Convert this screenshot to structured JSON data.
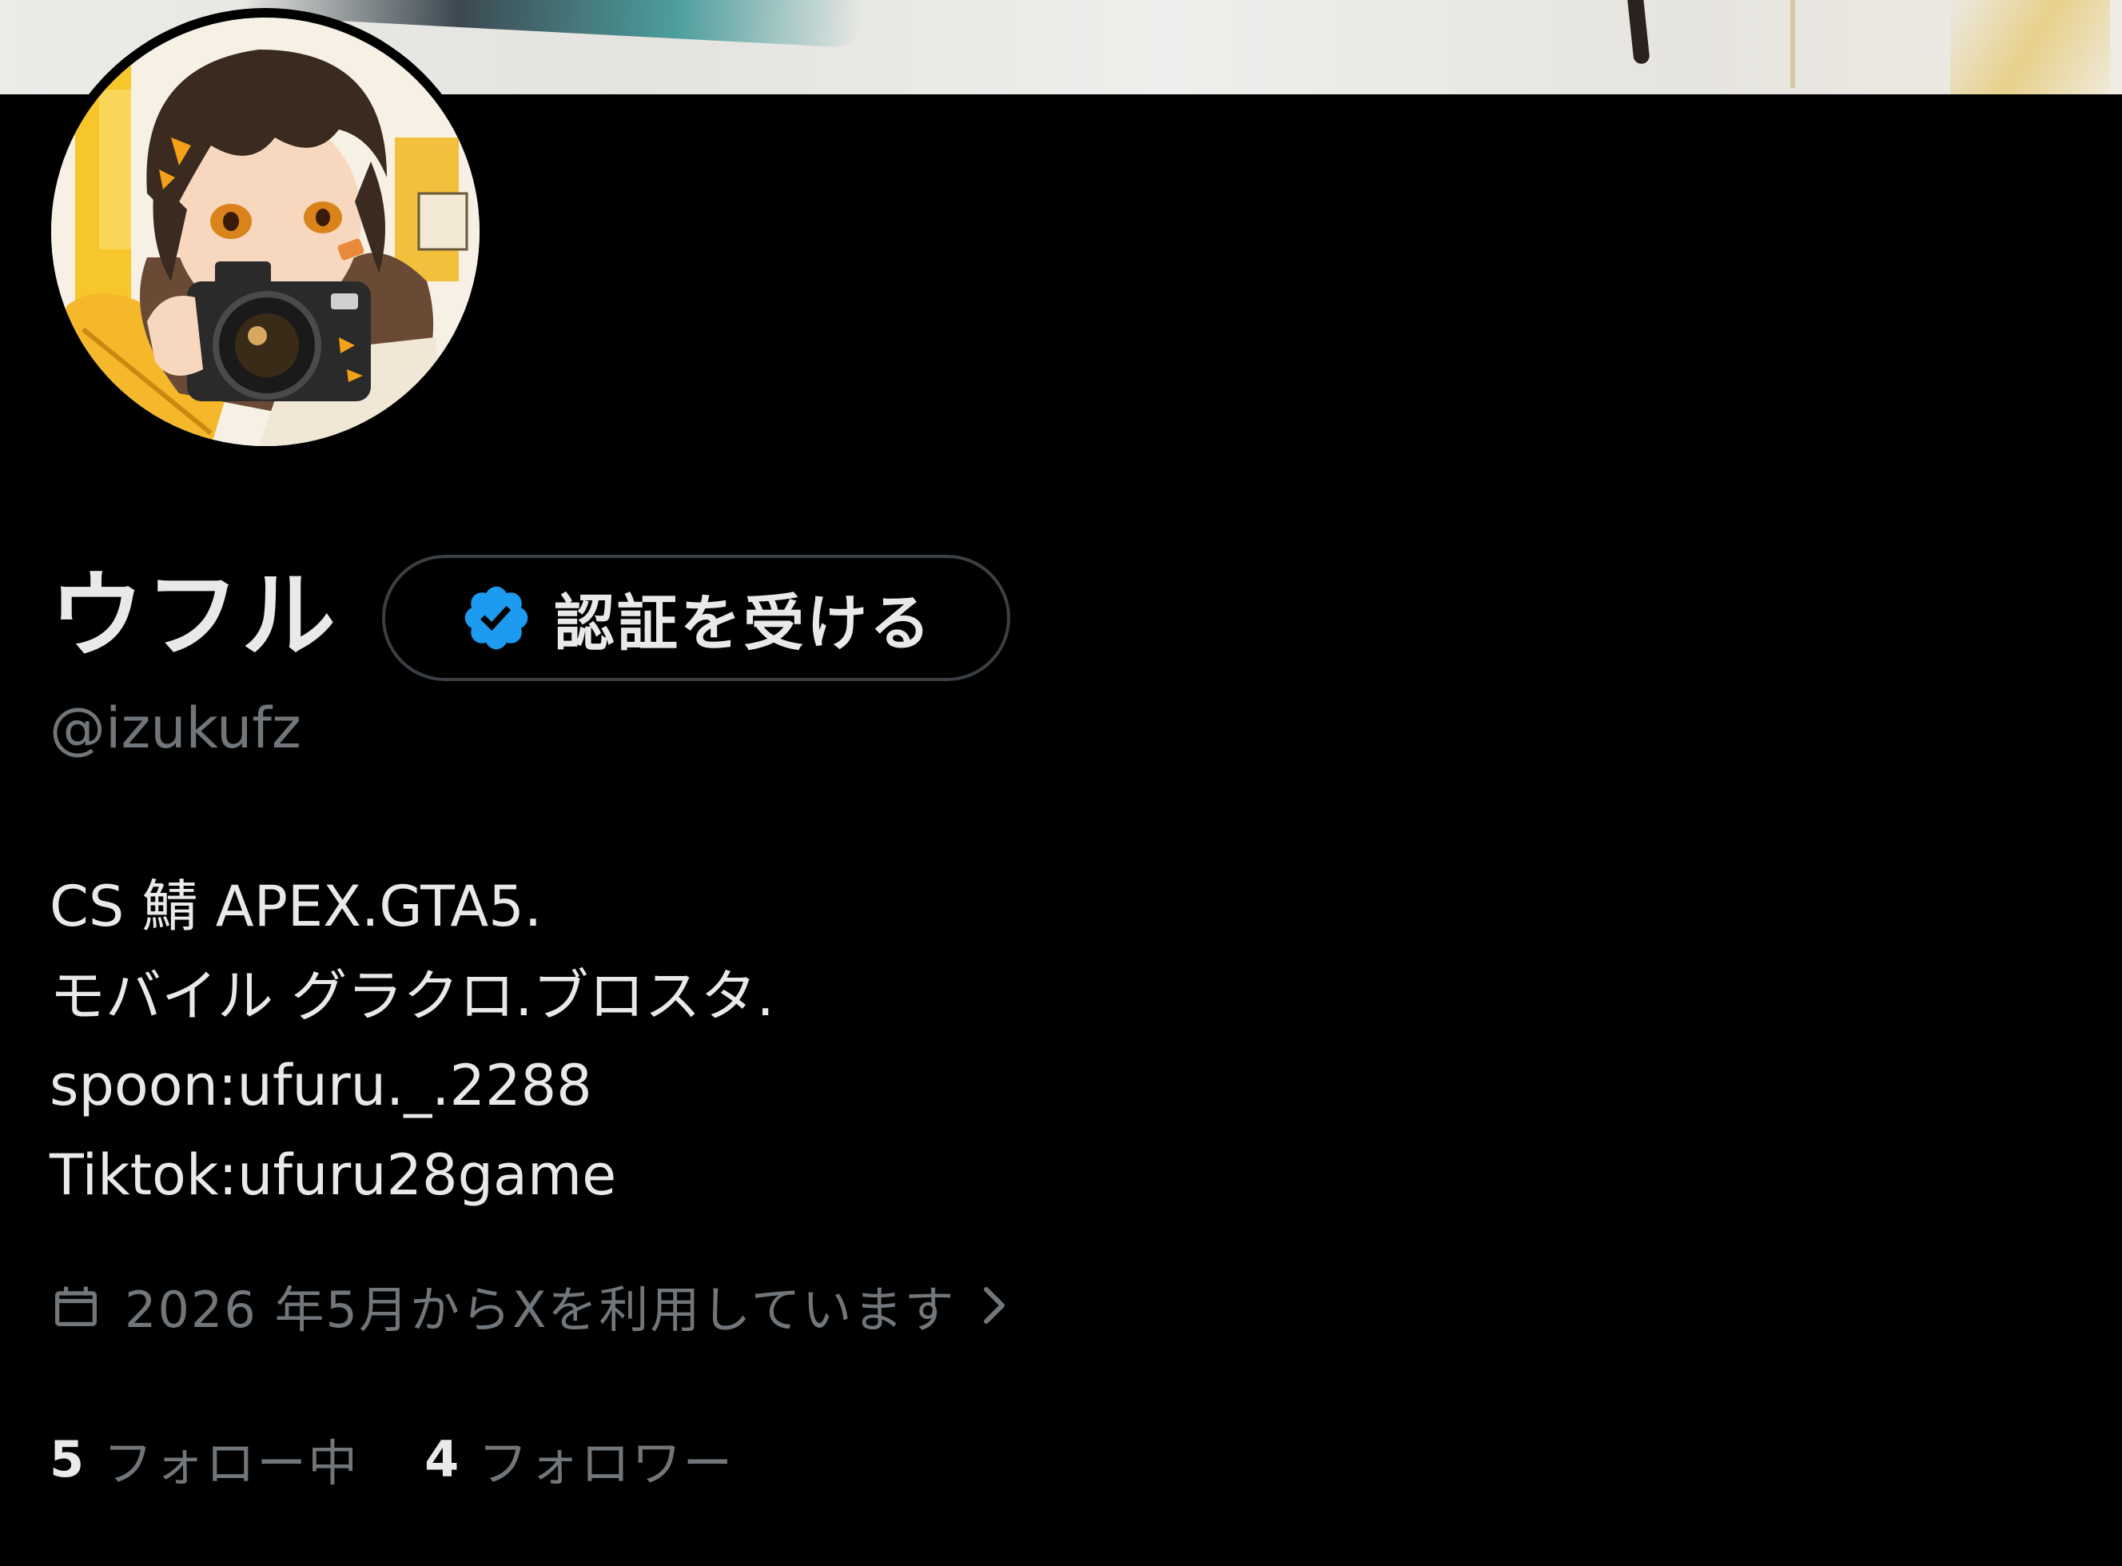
{
  "profile": {
    "display_name": "ウフル",
    "handle": "@izukufz",
    "verify_button_label": "認証を受ける",
    "bio_lines": [
      "CS 鯖 APEX.GTA5.",
      "モバイル グラクロ.ブロスタ.",
      "spoon:ufuru._.2288",
      "Tiktok:ufuru28game"
    ],
    "joined_text": "2026 年5月からXを利用しています",
    "following_count": "5",
    "following_label": "フォロー中",
    "followers_count": "4",
    "followers_label": "フォロワー"
  },
  "icons": {
    "verified": "verified-badge-icon",
    "calendar": "calendar-icon",
    "chevron": "chevron-right-icon"
  },
  "colors": {
    "background": "#000000",
    "primary_text": "#e7e9ea",
    "secondary_text": "#71767b",
    "verified_blue": "#1d9bf0",
    "button_border": "#3b4045"
  }
}
